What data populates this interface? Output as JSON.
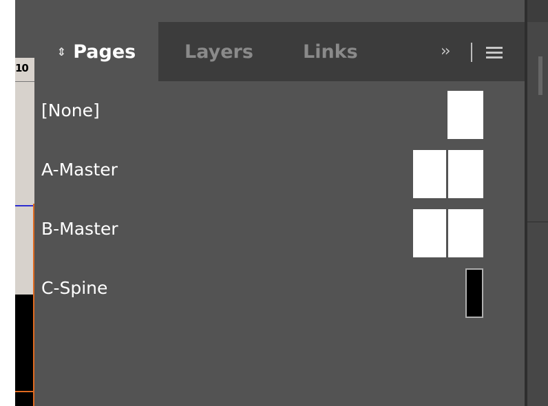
{
  "canvas": {
    "ruler_text": "10"
  },
  "tabs": {
    "pages": {
      "label": "Pages",
      "icon": "updown-arrows-icon"
    },
    "layers": {
      "label": "Layers"
    },
    "links": {
      "label": "Links"
    }
  },
  "panel_menu": {
    "overflow_glyph": "››",
    "menu_icon": "hamburger-icon"
  },
  "masters": [
    {
      "label": "[None]",
      "thumb": "single-page"
    },
    {
      "label": "A-Master",
      "thumb": "spread"
    },
    {
      "label": "B-Master",
      "thumb": "spread"
    },
    {
      "label": "C-Spine",
      "thumb": "spine"
    }
  ],
  "colors": {
    "panel_bg": "#535353",
    "tab_bar_bg": "#3c3c3c",
    "active_tab_text": "#ffffff",
    "inactive_tab_text": "#8a8a8a"
  }
}
